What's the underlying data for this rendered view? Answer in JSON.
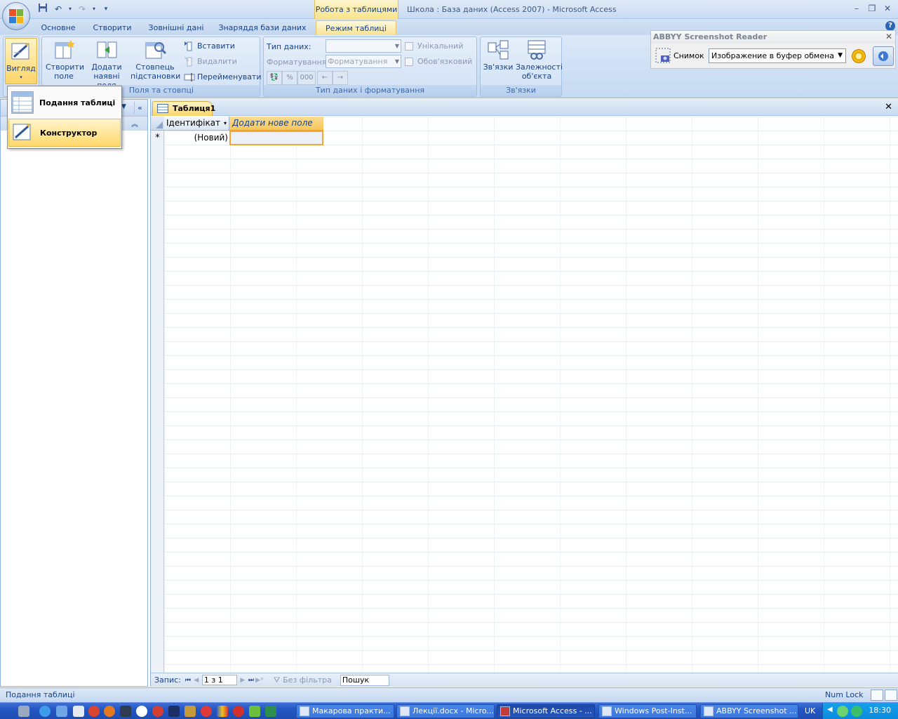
{
  "titlebar": {
    "context_tab_group": "Робота з таблицями",
    "app_title": "Школа : База даних (Access 2007)  -  Microsoft Access",
    "help_glyph": "?"
  },
  "tabs": [
    {
      "label": "Основне"
    },
    {
      "label": "Створити"
    },
    {
      "label": "Зовнішні дані"
    },
    {
      "label": "Знаряддя бази даних"
    },
    {
      "label": "Режим таблиці",
      "active": true
    }
  ],
  "ribbon": {
    "view_label": "Вигляд",
    "fields_group": {
      "create_field": "Створити поле",
      "add_existing": "Додати наявні поля",
      "lookup_column": "Стовпець підстановки",
      "insert": "Вставити",
      "delete": "Видалити",
      "rename": "Перейменувати",
      "label": "Поля та стовпці"
    },
    "datatype_group": {
      "data_type_label": "Тип даних:",
      "data_type_value": "",
      "format_label": "Форматування:",
      "format_value": "Форматування",
      "unique_label": "Унікальний",
      "required_label": "Обов'язковий",
      "percent_glyph": "%",
      "thousands_glyph": "000",
      "label": "Тип даних і форматування"
    },
    "relations_group": {
      "relationships": "Зв'язки",
      "dependencies": "Залежності об'єкта",
      "label": "Зв'язки"
    }
  },
  "abbyy": {
    "title": "ABBYY Screenshot Reader",
    "snapshot_label": "Снимок",
    "target_value": "Изображение в буфер обмена"
  },
  "view_menu": {
    "items": [
      {
        "label": "Подання таблиці",
        "icon": "datasheet-view-icon"
      },
      {
        "label": "Конструктор",
        "icon": "design-view-icon",
        "highlighted": true
      }
    ]
  },
  "document": {
    "tab_label": "Таблиця1",
    "columns": [
      "Ідентифікат",
      "Додати нове поле"
    ],
    "new_row_marker": "*",
    "new_row_value": "(Новий)"
  },
  "record_nav": {
    "label": "Запис:",
    "position": "1 з 1",
    "filter_label": "Без фільтра",
    "search_label": "Пошук"
  },
  "statusbar": {
    "text": "Подання таблиці",
    "numlock": "Num Lock"
  },
  "taskbar": {
    "tasks": [
      {
        "label": "Макарова практи...",
        "icon": "word-doc-icon"
      },
      {
        "label": "Лекції.docx - Micro...",
        "icon": "word-doc-icon"
      },
      {
        "label": "Microsoft Access - ...",
        "icon": "access-icon",
        "active": true
      },
      {
        "label": "Windows Post-Inst...",
        "icon": "installer-icon"
      },
      {
        "label": "ABBYY Screenshot ...",
        "icon": "abbyy-icon"
      }
    ],
    "language": "UK",
    "clock": "18:30"
  }
}
